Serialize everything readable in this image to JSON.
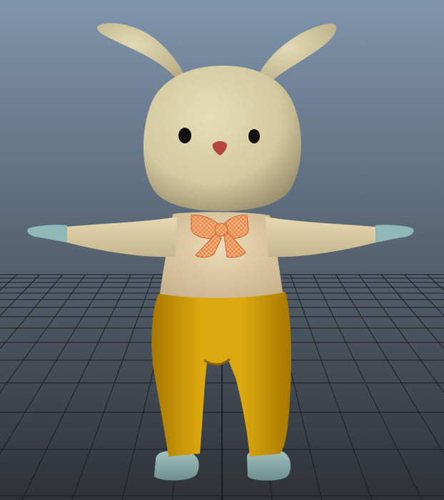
{
  "viewport": {
    "background_top": "#7f95ac",
    "background_bottom": "#2e3236",
    "grid_color": "#1c1f22",
    "grid_major_color": "#111315"
  },
  "model": {
    "fur_color": "#d9cfa8",
    "fur_shadow": "#a89d76",
    "body_color": "#e3cfaa",
    "pants_color": "#d9a207",
    "pants_shadow": "#9c7000",
    "shoe_color": "#8fb3b0",
    "hand_color": "#8fb8b6",
    "nose_color": "#b5453d",
    "eye_color": "#111111",
    "bow_color": "#e9874d"
  }
}
